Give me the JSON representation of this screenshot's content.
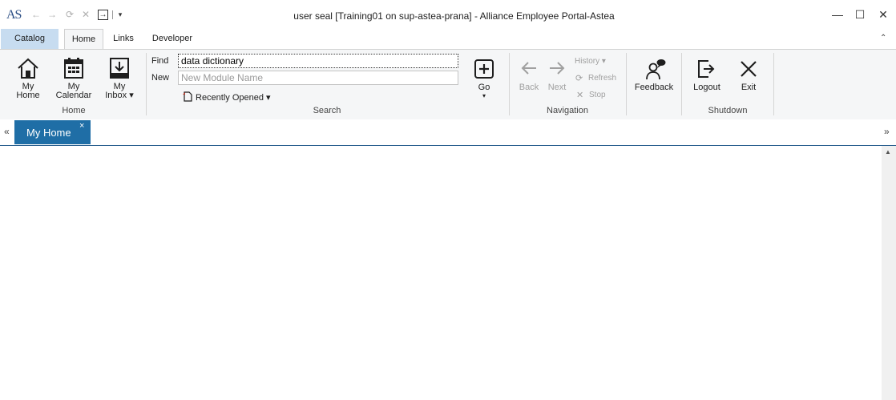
{
  "title_bar": {
    "logo": "AS",
    "title": "user seal  [Training01 on sup-astea-prana] - Alliance Employee Portal-Astea",
    "quick_access": {
      "back": "←",
      "forward": "→",
      "refresh": "⟳",
      "stop": "✕",
      "dock": "→",
      "menu": "▾"
    },
    "window_buttons": {
      "minimize": "—",
      "maximize": "☐",
      "close": "✕"
    }
  },
  "ribbon": {
    "tabs": [
      "Catalog",
      "Home",
      "Links",
      "Developer"
    ],
    "active_tab": "Home",
    "collapse": "⌃",
    "groups": {
      "home": {
        "label": "Home",
        "my_home": [
          "My",
          "Home"
        ],
        "my_calendar": [
          "My",
          "Calendar"
        ],
        "my_inbox": [
          "My",
          "Inbox ▾"
        ]
      },
      "search": {
        "label": "Search",
        "find_label": "Find",
        "find_value": "data dictionary",
        "new_label": "New",
        "new_placeholder": "New Module Name",
        "recently_opened": "Recently Opened ▾",
        "go": "Go",
        "go_caret": "▾"
      },
      "navigation": {
        "label": "Navigation",
        "back": "Back",
        "next": "Next",
        "history": "History ▾",
        "refresh": "Refresh",
        "stop": "Stop"
      },
      "feedback": {
        "label": "Feedback"
      },
      "shutdown": {
        "label": "Shutdown",
        "logout": "Logout",
        "exit": "Exit"
      }
    }
  },
  "doc_tabs": {
    "left_scroll": "«",
    "right_scroll": "»",
    "tabs": [
      {
        "label": "My Home",
        "close": "×"
      }
    ]
  },
  "colors": {
    "accent": "#1f6ea6",
    "catalog_tab": "#c7dcf0",
    "ribbon_bg": "#f5f6f7"
  }
}
